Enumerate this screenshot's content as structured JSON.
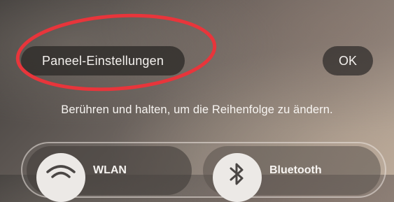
{
  "header": {
    "panel_settings_label": "Paneel-Einstellungen",
    "ok_label": "OK"
  },
  "instruction_text": "Berühren und halten, um die Reihenfolge zu ändern.",
  "tiles": [
    {
      "label": "WLAN",
      "icon": "wifi-icon"
    },
    {
      "label": "Bluetooth",
      "icon": "bluetooth-icon"
    }
  ],
  "annotation": {
    "shape": "ellipse",
    "color": "#e8353b"
  }
}
